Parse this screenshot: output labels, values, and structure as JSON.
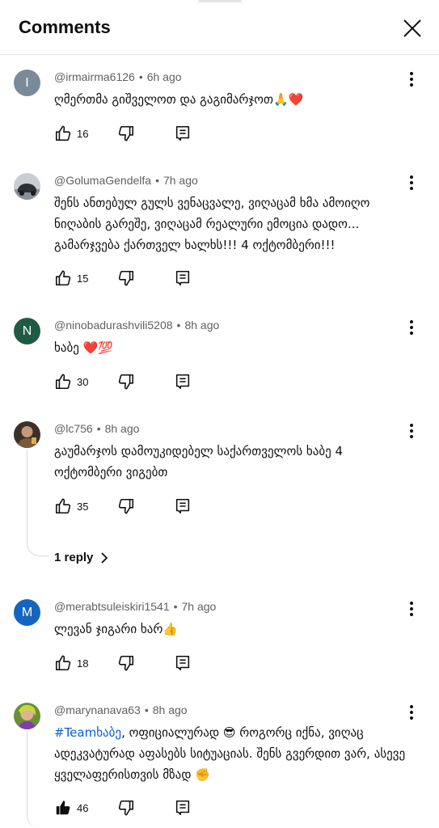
{
  "header": {
    "title": "Comments"
  },
  "comments": [
    {
      "author": "@irmairma6126",
      "time": "6h ago",
      "avatar_letter": "I",
      "avatar_color": "#7b8a99",
      "text": "ღმერთმა გიშველოთ და გაგიმარჯოთ🙏❤️",
      "likes": "16"
    },
    {
      "author": "@GolumaGendelfa",
      "time": "7h ago",
      "avatar_letter": "",
      "avatar_color": "#9aa3ad",
      "text": "შენს ანთებულ გულს ვენაცვალე, ვიღაცამ ხმა ამოიღო ნიღაბის გარეშე, ვიღაცამ რეალური ემოცია დადო... გამარჯვება ქართველ ხალხს!!! 4 ოქტომბერი!!!",
      "likes": "15"
    },
    {
      "author": "@ninobadurashvili5208",
      "time": "8h ago",
      "avatar_letter": "N",
      "avatar_color": "#1f5a44",
      "text": "ხაბე ❤️💯",
      "likes": "30"
    },
    {
      "author": "@lc756",
      "time": "8h ago",
      "avatar_letter": "",
      "avatar_color": "#5b4636",
      "text": "გაუმარჯოს დამოუკიდებელ საქართველოს ხაბე 4 ოქტომბერი ვიგებთ",
      "likes": "35",
      "replies_label": "1 reply"
    },
    {
      "author": "@merabtsuleiskiri1541",
      "time": "7h ago",
      "avatar_letter": "M",
      "avatar_color": "#1565c0",
      "text": "ლევან ჯიგარი ხარ👍",
      "likes": "18"
    },
    {
      "author": "@marynanava63",
      "time": "8h ago",
      "avatar_letter": "",
      "avatar_color": "#6b8f3a",
      "hashtag": "#Teamხაბე",
      "text": ", ოფიციალურად 😎 როგორც იქნა, ვიღაც ადეკვატურად აფასებს სიტუაციას. შენს გვერდით ვარ, ასევე ყველაფერისთვის მზად ✊",
      "likes": "46"
    }
  ],
  "icons": {
    "close": "close-icon",
    "more": "more-vert-icon",
    "like": "thumb-up-icon",
    "dislike": "thumb-down-icon",
    "reply": "comment-reply-icon",
    "chevron": "chevron-right-icon"
  }
}
